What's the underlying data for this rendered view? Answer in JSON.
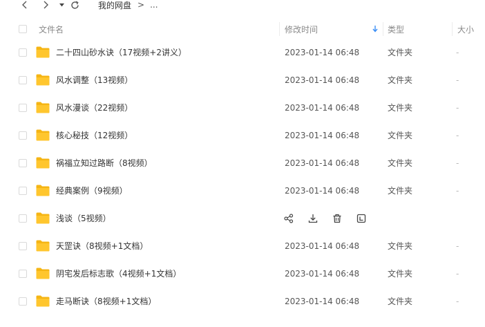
{
  "nav": {
    "breadcrumb_root": "我的网盘",
    "breadcrumb_separator": ">",
    "breadcrumb_more": "..."
  },
  "header": {
    "name": "文件名",
    "modified": "修改时间",
    "type": "类型",
    "size": "大小",
    "sort_icon": "arrow-down-icon"
  },
  "colors": {
    "folder": "#ffc62e",
    "folder_tab": "#f5b514",
    "sort_arrow": "#3a8ef6",
    "text": "#333333"
  },
  "rows": [
    {
      "name": "二十四山砂水诀（17视频+2讲义）",
      "modified": "2023-01-14 06:48",
      "type": "文件夹",
      "size": "-"
    },
    {
      "name": "风水调整（13视频）",
      "modified": "2023-01-14 06:48",
      "type": "文件夹",
      "size": "-"
    },
    {
      "name": "风水漫谈（22视频）",
      "modified": "2023-01-14 06:48",
      "type": "文件夹",
      "size": "-"
    },
    {
      "name": "核心秘技（12视频）",
      "modified": "2023-01-14 06:48",
      "type": "文件夹",
      "size": "-"
    },
    {
      "name": "祸福立知过路断（8视频）",
      "modified": "2023-01-14 06:48",
      "type": "文件夹",
      "size": "-"
    },
    {
      "name": "经典案例（9视频）",
      "modified": "2023-01-14 06:48",
      "type": "文件夹",
      "size": "-"
    },
    {
      "name": "浅谈（5视频）",
      "modified": "",
      "type": "",
      "size": "",
      "hovered": true,
      "actions": [
        "share-icon",
        "download-icon",
        "delete-icon",
        "more-icon"
      ]
    },
    {
      "name": "天罡诀（8视频+1文档）",
      "modified": "2023-01-14 06:48",
      "type": "文件夹",
      "size": "-"
    },
    {
      "name": "阴宅发后标志歌（4视频+1文档）",
      "modified": "2023-01-14 06:48",
      "type": "文件夹",
      "size": "-"
    },
    {
      "name": "走马断诀（8视频+1文档）",
      "modified": "2023-01-14 06:48",
      "type": "文件夹",
      "size": "-"
    }
  ]
}
